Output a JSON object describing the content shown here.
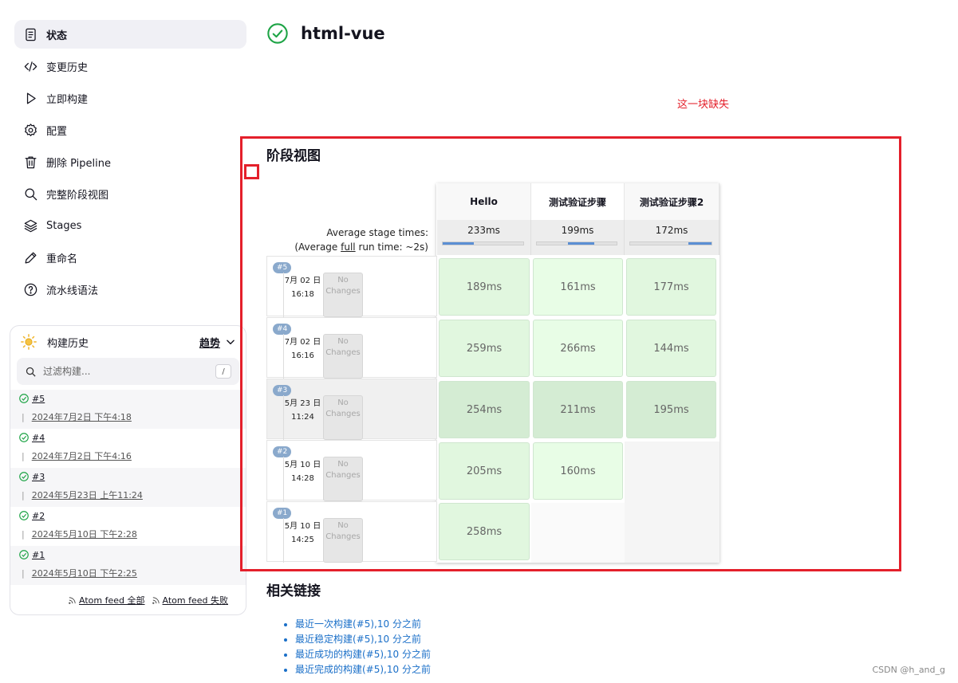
{
  "nav": [
    {
      "label": "状态",
      "icon": "document-icon",
      "active": true
    },
    {
      "label": "变更历史",
      "icon": "code-icon"
    },
    {
      "label": "立即构建",
      "icon": "play-icon"
    },
    {
      "label": "配置",
      "icon": "gear-icon"
    },
    {
      "label": "删除 Pipeline",
      "icon": "trash-icon"
    },
    {
      "label": "完整阶段视图",
      "icon": "search-icon"
    },
    {
      "label": "Stages",
      "icon": "layers-icon"
    },
    {
      "label": "重命名",
      "icon": "pencil-icon"
    },
    {
      "label": "流水线语法",
      "icon": "help-icon"
    }
  ],
  "history": {
    "title": "构建历史",
    "trend": "趋势",
    "filter_placeholder": "过滤构建...",
    "filter_shortcut": "/",
    "builds": [
      {
        "num": "#5",
        "date": "2024年7月2日 下午4:18"
      },
      {
        "num": "#4",
        "date": "2024年7月2日 下午4:16"
      },
      {
        "num": "#3",
        "date": "2024年5月23日 上午11:24"
      },
      {
        "num": "#2",
        "date": "2024年5月10日 下午2:28"
      },
      {
        "num": "#1",
        "date": "2024年5月10日 下午2:25"
      }
    ],
    "feed_all": "Atom feed 全部",
    "feed_failed": "Atom feed 失败"
  },
  "page": {
    "title": "html-vue",
    "annotation": "这一块缺失",
    "stage_view_title": "阶段视图",
    "related_title": "相关链接"
  },
  "stage_view": {
    "stages": [
      {
        "name": "Hello",
        "avg": "233ms",
        "bar_start": 0.0,
        "bar_fill": 0.39
      },
      {
        "name": "测试验证步骤",
        "avg": "199ms",
        "bar_start": 0.39,
        "bar_fill": 0.33
      },
      {
        "name": "测试验证步骤2",
        "avg": "172ms",
        "bar_start": 0.72,
        "bar_fill": 0.28
      }
    ],
    "avg_label_1": "Average stage times:",
    "avg_label_2_pre": "(Average ",
    "avg_label_2_full": "full",
    "avg_label_2_post": " run time: ~2s)",
    "no_changes": "No Changes",
    "runs": [
      {
        "badge": "#5",
        "date": "7月 02 日",
        "time": "16:18",
        "cells": [
          "189ms",
          "161ms",
          "177ms"
        ]
      },
      {
        "badge": "#4",
        "date": "7月 02 日",
        "time": "16:16",
        "cells": [
          "259ms",
          "266ms",
          "144ms"
        ]
      },
      {
        "badge": "#3",
        "date": "5月 23 日",
        "time": "11:24",
        "cells": [
          "254ms",
          "211ms",
          "195ms"
        ]
      },
      {
        "badge": "#2",
        "date": "5月 10 日",
        "time": "14:28",
        "cells": [
          "205ms",
          "160ms",
          ""
        ]
      },
      {
        "badge": "#1",
        "date": "5月 10 日",
        "time": "14:25",
        "cells": [
          "258ms",
          "",
          ""
        ]
      }
    ]
  },
  "related_links": [
    "最近一次构建(#5),10 分之前",
    "最近稳定构建(#5),10 分之前",
    "最近成功的构建(#5),10 分之前",
    "最近完成的构建(#5),10 分之前"
  ],
  "watermark": "CSDN @h_and_g",
  "colors": {
    "accent_green": "#1ea446",
    "annotation_red": "#e4202b",
    "link_blue": "#1a6fc8"
  }
}
